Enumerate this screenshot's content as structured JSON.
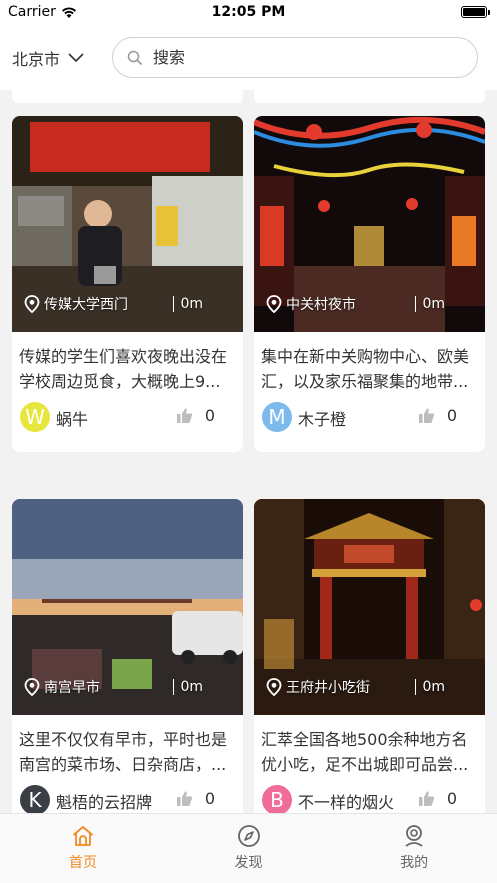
{
  "status_bar": {
    "carrier": "Carrier",
    "time": "12:05 PM"
  },
  "header": {
    "city": "北京市",
    "search_placeholder": "搜索"
  },
  "colors": {
    "accent": "#f08a24",
    "tab_inactive": "#666666"
  },
  "cards": [
    {
      "location": "传媒大学西门",
      "distance": "0m",
      "description": "传媒的学生们喜欢夜晚出没在学校周边觅食，大概晚上9...",
      "user": "蜗牛",
      "avatar_letter": "W",
      "avatar_color": "#e6e63d",
      "likes": "0",
      "scene": "street-food-stall"
    },
    {
      "location": "中关村夜市",
      "distance": "0m",
      "description": "集中在新中关购物中心、欧美汇，以及家乐福聚集的地带...",
      "user": "木子橙",
      "avatar_letter": "M",
      "avatar_color": "#7cb9ec",
      "likes": "0",
      "scene": "night-market-lanterns"
    },
    {
      "location": "南宫早市",
      "distance": "0m",
      "description": "这里不仅仅有早市，平时也是南宫的菜市场、日杂商店，...",
      "user": "魁梧的云招牌",
      "avatar_letter": "K",
      "avatar_color": "#3a3f45",
      "likes": "0",
      "scene": "morning-market-dusk"
    },
    {
      "location": "王府井小吃街",
      "distance": "0m",
      "description": "汇萃全国各地500余种地方名优小吃，足不出城即可品尝...",
      "user": "不一样的烟火",
      "avatar_letter": "B",
      "avatar_color": "#f06c9b",
      "likes": "0",
      "scene": "snack-street-gate"
    }
  ],
  "tabs": [
    {
      "label": "首页",
      "icon": "home-icon",
      "active": true
    },
    {
      "label": "发现",
      "icon": "compass-icon",
      "active": false
    },
    {
      "label": "我的",
      "icon": "profile-icon",
      "active": false
    }
  ]
}
